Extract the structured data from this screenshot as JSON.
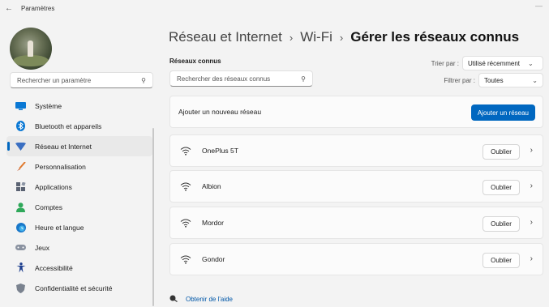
{
  "window": {
    "title": "Paramètres",
    "back_icon": "back-arrow-icon"
  },
  "sidebar": {
    "search_placeholder": "Rechercher un paramètre",
    "items": [
      {
        "label": "Système",
        "icon": "system-icon",
        "active": false
      },
      {
        "label": "Bluetooth et appareils",
        "icon": "bluetooth-icon",
        "active": false
      },
      {
        "label": "Réseau et Internet",
        "icon": "wifi-icon",
        "active": true
      },
      {
        "label": "Personnalisation",
        "icon": "brush-icon",
        "active": false
      },
      {
        "label": "Applications",
        "icon": "apps-icon",
        "active": false
      },
      {
        "label": "Comptes",
        "icon": "account-icon",
        "active": false
      },
      {
        "label": "Heure et langue",
        "icon": "clock-globe-icon",
        "active": false
      },
      {
        "label": "Jeux",
        "icon": "gamepad-icon",
        "active": false
      },
      {
        "label": "Accessibilité",
        "icon": "accessibility-icon",
        "active": false
      },
      {
        "label": "Confidentialité et sécurité",
        "icon": "shield-icon",
        "active": false
      }
    ]
  },
  "breadcrumb": {
    "level1": "Réseau et Internet",
    "level2": "Wi-Fi",
    "current": "Gérer les réseaux connus",
    "separator": "›"
  },
  "known_networks": {
    "section_label": "Réseaux connus",
    "search_placeholder": "Rechercher des réseaux connus",
    "sort_label": "Trier par :",
    "sort_value": "Utilisé récemment",
    "filter_label": "Filtrer par :",
    "filter_value": "Toutes",
    "add_card_label": "Ajouter un nouveau réseau",
    "add_button_label": "Ajouter un réseau",
    "forget_label": "Oublier",
    "networks": [
      {
        "name": "OnePlus 5T"
      },
      {
        "name": "Albion"
      },
      {
        "name": "Mordor"
      },
      {
        "name": "Gondor"
      }
    ]
  },
  "help": {
    "label": "Obtenir de l'aide"
  },
  "colors": {
    "accent": "#0067c0",
    "background": "#f3f3f3",
    "card": "#fbfbfb"
  }
}
